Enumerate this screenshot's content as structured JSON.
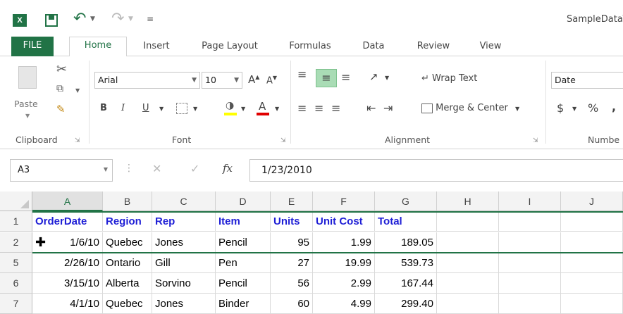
{
  "title_bar": {
    "doc_title": "SampleDataT",
    "app_icon": "excel-icon",
    "qat": [
      "save-icon",
      "undo-icon",
      "redo-icon",
      "customize-icon"
    ]
  },
  "tabs": [
    "FILE",
    "Home",
    "Insert",
    "Page Layout",
    "Formulas",
    "Data",
    "Review",
    "View"
  ],
  "ribbon": {
    "clipboard": {
      "label": "Clipboard",
      "paste": "Paste"
    },
    "font": {
      "label": "Font",
      "name": "Arial",
      "size": "10",
      "bold": "B",
      "italic": "I",
      "underline": "U"
    },
    "alignment": {
      "label": "Alignment",
      "wrap": "Wrap Text",
      "merge": "Merge & Center"
    },
    "number": {
      "label": "Numbe",
      "format": "Date",
      "currency": "$",
      "percent": "%",
      "comma": ","
    }
  },
  "formula_bar": {
    "name_box": "A3",
    "fx": "fx",
    "value": "1/23/2010"
  },
  "grid": {
    "columns": [
      "A",
      "B",
      "C",
      "D",
      "E",
      "F",
      "G",
      "H",
      "I",
      "J"
    ],
    "rows": [
      {
        "num": "1",
        "cells": [
          "OrderDate",
          "Region",
          "Rep",
          "Item",
          "Units",
          "Unit Cost",
          "Total"
        ]
      },
      {
        "num": "2",
        "cells": [
          "1/6/10",
          "Quebec",
          "Jones",
          "Pencil",
          "95",
          "1.99",
          "189.05"
        ]
      },
      {
        "num": "5",
        "cells": [
          "2/26/10",
          "Ontario",
          "Gill",
          "Pen",
          "27",
          "19.99",
          "539.73"
        ]
      },
      {
        "num": "6",
        "cells": [
          "3/15/10",
          "Alberta",
          "Sorvino",
          "Pencil",
          "56",
          "2.99",
          "167.44"
        ]
      },
      {
        "num": "7",
        "cells": [
          "4/1/10",
          "Quebec",
          "Jones",
          "Binder",
          "60",
          "4.99",
          "299.40"
        ]
      }
    ]
  },
  "colors": {
    "accent": "#217346",
    "header_text": "#1f1fd6"
  }
}
